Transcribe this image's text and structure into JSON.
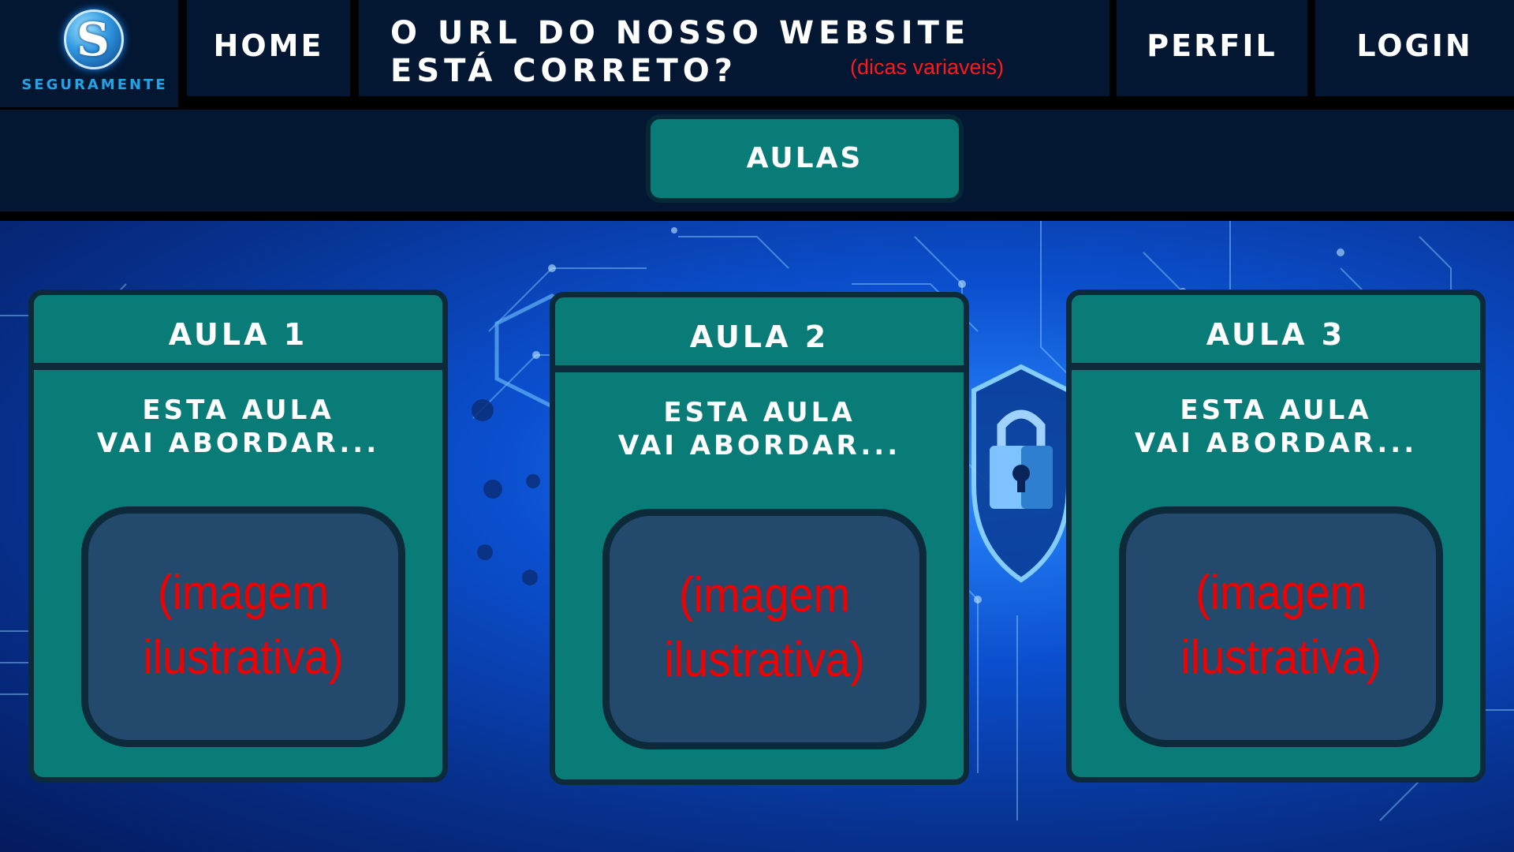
{
  "app": {
    "brand": "SEGURAMENTE",
    "logo_letter": "S"
  },
  "nav": {
    "home": "HOME",
    "title_line1": "O URL DO NOSSO WEBSITE",
    "title_line2": "ESTÁ CORRETO?",
    "title_note": "(dicas variaveis)",
    "perfil": "PERFIL",
    "login": "LOGIN"
  },
  "subnav": {
    "aulas": "AULAS"
  },
  "cards": [
    {
      "title": "AULA 1",
      "desc_line1": "ESTA AULA",
      "desc_line2": "VAI ABORDAR...",
      "image_line1": "(imagem",
      "image_line2": "ilustrativa)"
    },
    {
      "title": "AULA 2",
      "desc_line1": "ESTA AULA",
      "desc_line2": "VAI ABORDAR...",
      "image_line1": "(imagem",
      "image_line2": "ilustrativa)"
    },
    {
      "title": "AULA 3",
      "desc_line1": "ESTA AULA",
      "desc_line2": "VAI ABORDAR...",
      "image_line1": "(imagem",
      "image_line2": "ilustrativa)"
    }
  ],
  "colors": {
    "navy": "#031733",
    "teal": "#0a7c78",
    "border": "#0d2a3a",
    "placeholder_red": "#f20000"
  },
  "icons": {
    "logo": "logo-s-icon",
    "background": "cyber-circuit-lock-background"
  }
}
